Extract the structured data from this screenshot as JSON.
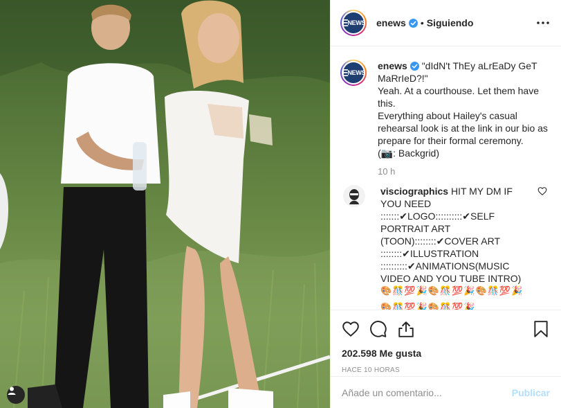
{
  "post": {
    "username": "enews",
    "follow_status": "Siguiendo",
    "separator": "•",
    "logo_text": "E",
    "logo_sub": "NEWS"
  },
  "caption": {
    "username": "enews",
    "lines": [
      "\"dIdN't ThEy aLrEaDy GeT MaRrIeD?!\"",
      "Yeah. At a courthouse. Let them have this.",
      "Everything about Hailey's casual rehearsal look is at the link in our bio as prepare for their formal ceremony.",
      "(📷: Backgrid)"
    ],
    "time": "10 h"
  },
  "comment": {
    "username": "visciographics",
    "lines": [
      "HIT MY DM IF YOU NEED",
      ":::::::✔LOGO::::::::::✔SELF PORTRAIT ART (TOON)::::::::✔COVER ART ::::::::✔ILLUSTRATION",
      "::::::::::✔ANIMATIONS(MUSIC VIDEO AND YOU TUBE INTRO)"
    ],
    "emoji_line": "🎨🎊💯🎉🎨🎊💯🎉🎨🎊💯🎉",
    "emoji_line_2": "🎨🎊💯🎉🎨🎊💯🎉"
  },
  "actions": {
    "likes": "202.598 Me gusta",
    "time_ago": "HACE 10 HORAS"
  },
  "add_comment": {
    "placeholder": "Añade un comentario...",
    "publish_label": "Publicar"
  },
  "icons": {
    "like": "heart-icon",
    "comment": "comment-icon",
    "share": "share-icon",
    "save": "bookmark-icon",
    "more": "more-icon",
    "verified": "verified-icon",
    "user_tag": "user-tag-icon"
  },
  "colors": {
    "verified": "#3897f0",
    "publish_disabled": "#b2dffc",
    "muted": "#8e8e8e"
  }
}
